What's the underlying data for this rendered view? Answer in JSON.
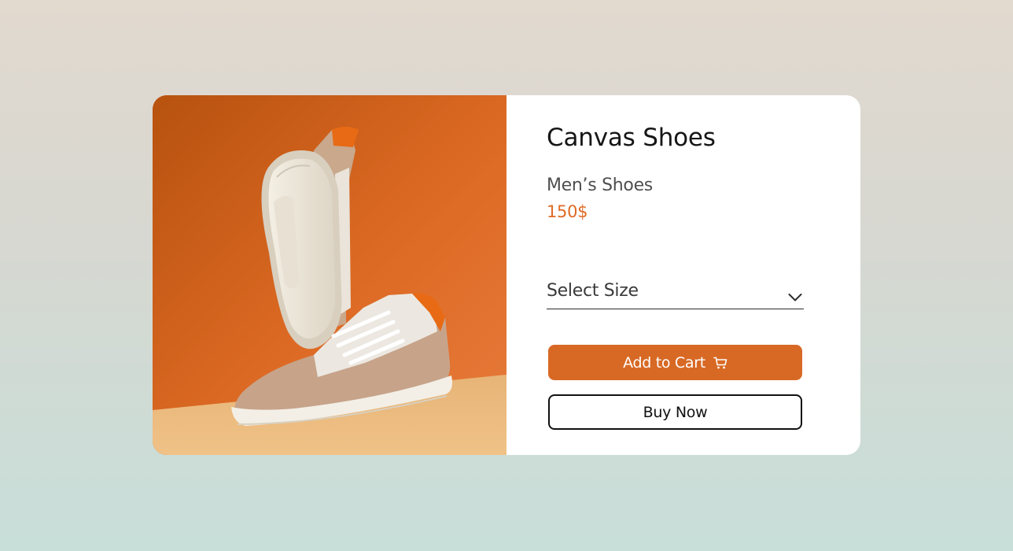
{
  "product": {
    "image_alt": "orange-white-canvas-sneakers-photo",
    "title": "Canvas Shoes",
    "category": "Men’s Shoes",
    "price": "150$"
  },
  "size_select": {
    "label": "Select Size",
    "icon": "chevron-down-icon"
  },
  "actions": {
    "add_to_cart_label": "Add to Cart",
    "add_to_cart_icon": "cart-icon",
    "buy_now_label": "Buy Now"
  },
  "colors": {
    "accent": "#d86924",
    "price": "#df6a24",
    "text": "#161616"
  }
}
